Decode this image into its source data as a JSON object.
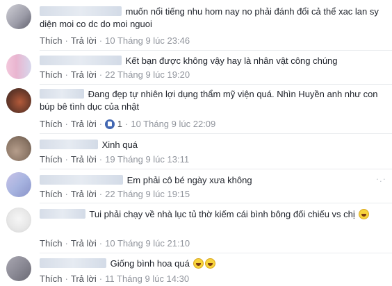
{
  "actions": {
    "like": "Thích",
    "reply": "Trả lời",
    "separator": "·"
  },
  "comments": [
    {
      "text": "muốn nổi tiếng nhu hom nay no phải đánh đổi cả thể xac lan sy diện moi co dc do moi nguoi",
      "time": "10 Tháng 9 lúc 23:46"
    },
    {
      "text": "Kết bạn được không vậy hay là nhân vật công chúng",
      "time": "22 Tháng 9 lúc 19:20"
    },
    {
      "text": "Đang đẹp tự nhiên lợi dụng thẩm mỹ viện quá. Nhìn Huyền anh như con búp bê tình dục của nhật",
      "reactions": "1",
      "time": "10 Tháng 9 lúc 22:09"
    },
    {
      "text": "Xinh quá",
      "time": "19 Tháng 9 lúc 13:11"
    },
    {
      "text": "Em phải cô bé ngày xưa không",
      "time": "22 Tháng 9 lúc 19:15"
    },
    {
      "text": "Tui phải chạy về nhà lục tủ thờ kiếm cái bình bông đối chiếu vs chị",
      "time": "10 Tháng 9 lúc 21:10"
    },
    {
      "text": "Giống bình hoa quá",
      "time": "11 Tháng 9 lúc 14:30"
    }
  ]
}
